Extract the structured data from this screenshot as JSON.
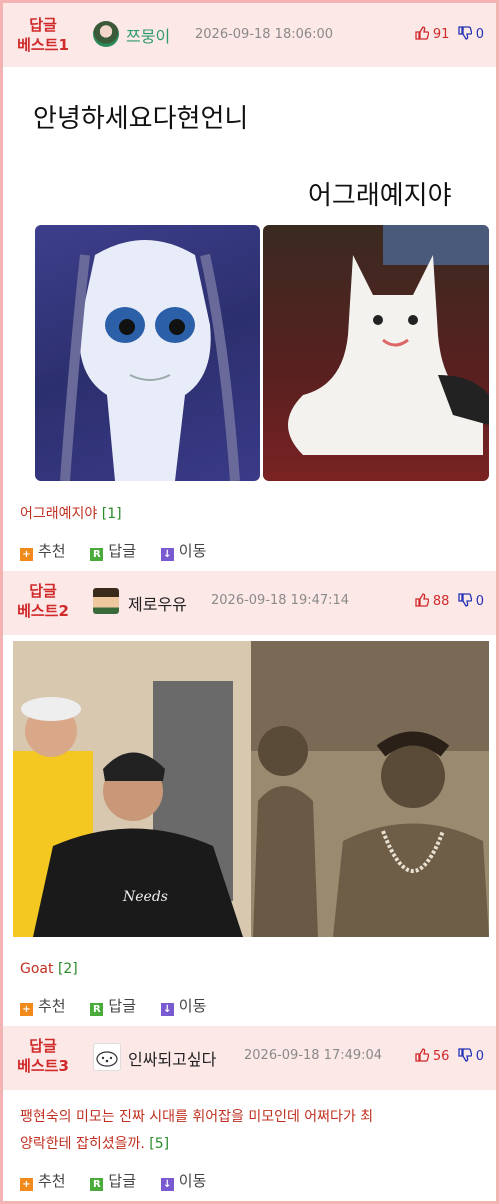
{
  "posts": [
    {
      "badge_line1": "답글",
      "badge_line2": "베스트1",
      "nick": "쯔뭉이",
      "time": "2026-09-18 18:06:00",
      "up": "91",
      "down": "0",
      "image_text_1": "안녕하세요다현언니",
      "image_text_2": "어그래예지야",
      "comment": "어그래예지야",
      "comment_count": "[1]"
    },
    {
      "badge_line1": "답글",
      "badge_line2": "베스트2",
      "nick": "제로우유",
      "time": "2026-09-18 19:47:14",
      "up": "88",
      "down": "0",
      "image_shirt_text": "Needs",
      "comment": "Goat",
      "comment_count": "[2]"
    },
    {
      "badge_line1": "답글",
      "badge_line2": "베스트3",
      "nick": "인싸되고싶다",
      "time": "2026-09-18 17:49:04",
      "up": "56",
      "down": "0",
      "comment_line1": "팽현숙의 미모는 진짜 시대를 휘어잡을 미모인데 어쩌다가 최",
      "comment_line2": "양락한테 잡히셨을까.",
      "comment_count": "[5]"
    }
  ],
  "actions": {
    "recommend": "추천",
    "reply": "답글",
    "move": "이동"
  },
  "icons": {
    "recommend": "plus-square-icon",
    "reply": "r-square-icon",
    "move": "down-arrow-square-icon",
    "thumb_up": "thumb-up-icon",
    "thumb_down": "thumb-down-icon"
  },
  "colors": {
    "header_bg": "#fde8e8",
    "border": "#f3b3b3",
    "badge": "#d02a2a",
    "upvote": "#d02a2a",
    "downvote": "#2332b5",
    "nick_green": "#2a9a6a",
    "comment_red": "#c03020"
  }
}
